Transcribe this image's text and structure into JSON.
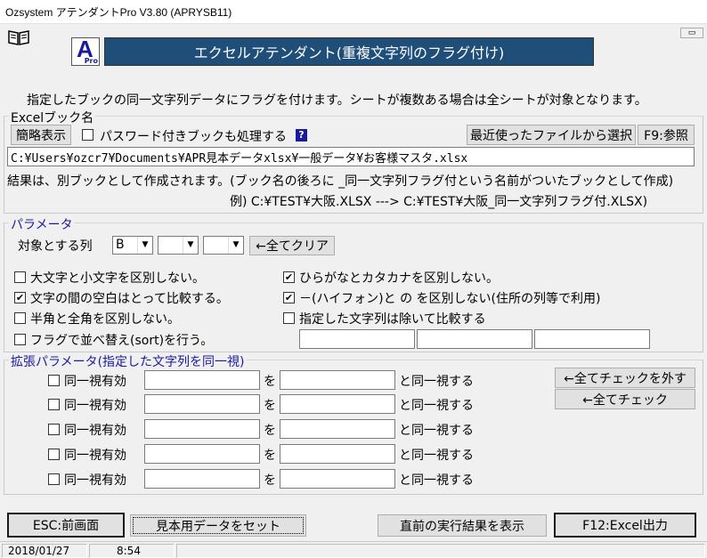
{
  "window": {
    "title": "Ozsystem アテンダントPro V3.80 (APRYSB11)",
    "minimize_symbol": "▭"
  },
  "logo": {
    "letter": "A",
    "sub": "Pro"
  },
  "header": {
    "title": "エクセルアテンダント(重複文字列のフラグ付け)",
    "description": "指定したブックの同一文字列データにフラグを付けます。シートが複数ある場合は全シートが対象となります。"
  },
  "excel_book": {
    "legend": "Excelブック名",
    "simple_display_button": "簡略表示",
    "password_checkbox_label": "パスワード付きブックも処理する",
    "password_checked": false,
    "help_button": "?",
    "recent_files_button": "最近使ったファイルから選択",
    "browse_button": "F9:参照",
    "path_value": "C:¥Users¥ozcr7¥Documents¥APR見本データxlsx¥一般データ¥お客様マスタ.xlsx",
    "note1": "結果は、別ブックとして作成されます。(ブック名の後ろに _同一文字列フラグ付という名前がついたブックとして作成)",
    "note2": "例) C:¥TEST¥大阪.XLSX ---> C:¥TEST¥大阪_同一文字列フラグ付.XLSX)"
  },
  "params": {
    "legend": "パラメータ",
    "target_column_label": "対象とする列",
    "column_select_1": "B",
    "column_select_2": "",
    "column_select_3": "",
    "clear_all_button": "←全てクリア",
    "options": [
      {
        "label": "大文字と小文字を区別しない。",
        "checked": false
      },
      {
        "label": "文字の間の空白はとって比較する。",
        "checked": true
      },
      {
        "label": "半角と全角を区別しない。",
        "checked": false
      },
      {
        "label": "フラグで並べ替え(sort)を行う。",
        "checked": false
      },
      {
        "label": "ひらがなとカタカナを区別しない。",
        "checked": true
      },
      {
        "label": "－(ハイフォン)と の を区別しない(住所の列等で利用)",
        "checked": true
      },
      {
        "label": "指定した文字列は除いて比較する",
        "checked": false
      }
    ],
    "exclude_1": "",
    "exclude_2": "",
    "exclude_3": ""
  },
  "extended": {
    "legend": "拡張パラメータ(指定した文字列を同一視)",
    "row_checkbox_label": "同一視有効",
    "wo": "を",
    "suffix": "と同一視する",
    "rows": [
      {
        "checked": false,
        "from": "",
        "to": ""
      },
      {
        "checked": false,
        "from": "",
        "to": ""
      },
      {
        "checked": false,
        "from": "",
        "to": ""
      },
      {
        "checked": false,
        "from": "",
        "to": ""
      },
      {
        "checked": false,
        "from": "",
        "to": ""
      }
    ],
    "uncheck_all_button": "←全てチェックを外す",
    "check_all_button": "←全てチェック"
  },
  "footer": {
    "esc_button": "ESC:前画面",
    "sample_button": "見本用データをセット",
    "last_result_button": "直前の実行結果を表示",
    "excel_output_button": "F12:Excel出力"
  },
  "status": {
    "date": "2018/01/27",
    "time": "8:54"
  },
  "colors": {
    "header_bg": "#1f4e79",
    "logo_letter": "#1a1aa0"
  }
}
